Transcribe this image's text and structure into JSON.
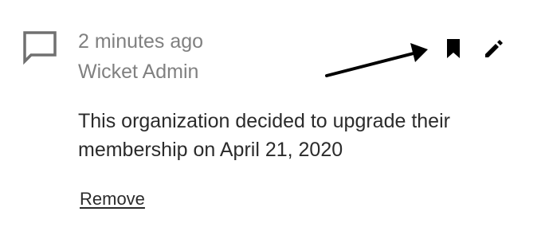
{
  "note": {
    "timestamp": "2 minutes ago",
    "author": "Wicket Admin",
    "body": "This organization decided to upgrade their membership on April 21, 2020",
    "remove_label": "Remove"
  },
  "icons": {
    "comment": "comment-icon",
    "bookmark": "bookmark-icon",
    "edit": "pencil-icon",
    "annotation": "arrow-annotation"
  },
  "colors": {
    "meta_text": "#808080",
    "body_text": "#2b2b2b",
    "icon": "#000000",
    "comment_icon": "#707070"
  }
}
